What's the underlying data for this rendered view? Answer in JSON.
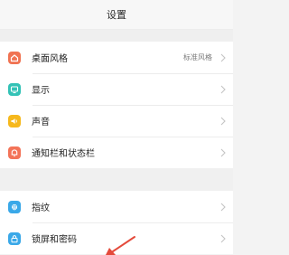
{
  "header": {
    "title": "设置"
  },
  "group1": {
    "items": [
      {
        "label": "桌面风格",
        "value": "标准风格",
        "icon": "home-icon",
        "color": "#f07352"
      },
      {
        "label": "显示",
        "value": "",
        "icon": "display-icon",
        "color": "#33c2b6"
      },
      {
        "label": "声音",
        "value": "",
        "icon": "speaker-icon",
        "color": "#f6b81c"
      },
      {
        "label": "通知栏和状态栏",
        "value": "",
        "icon": "bell-icon",
        "color": "#f37358"
      }
    ]
  },
  "group2": {
    "items": [
      {
        "label": "指纹",
        "value": "",
        "icon": "fingerprint-icon",
        "color": "#3aa8e8"
      },
      {
        "label": "锁屏和密码",
        "value": "",
        "icon": "lock-icon",
        "color": "#3aa8e8"
      }
    ]
  },
  "annotation": {
    "arrow_color": "#e44a3b"
  }
}
